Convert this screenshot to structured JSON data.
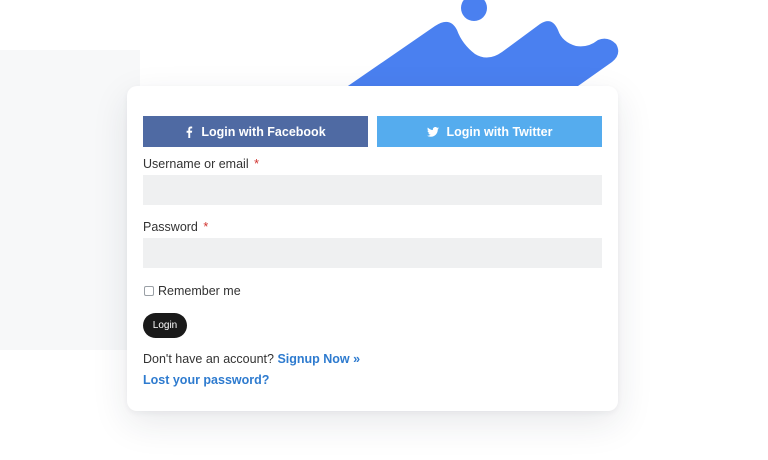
{
  "colors": {
    "facebook": "#4f6aa3",
    "twitter": "#55acee",
    "link": "#2e7bcf",
    "decoration": "#4a80f0",
    "required": "#d0312d",
    "login_button": "#1a1a1a",
    "field_background": "#eff0f1"
  },
  "social": {
    "facebook": {
      "icon": "facebook-icon",
      "label": "Login with Facebook"
    },
    "twitter": {
      "icon": "twitter-icon",
      "label": "Login with Twitter"
    }
  },
  "form": {
    "username": {
      "label": "Username or email",
      "required_mark": "*",
      "value": "",
      "placeholder": ""
    },
    "password": {
      "label": "Password",
      "required_mark": "*",
      "value": "",
      "placeholder": ""
    },
    "remember": {
      "label": "Remember me",
      "checked": false
    },
    "login_label": "Login"
  },
  "footer": {
    "signup_prompt": "Don't have an account?",
    "signup_link": "Signup Now »",
    "lost_password": "Lost your password?"
  }
}
